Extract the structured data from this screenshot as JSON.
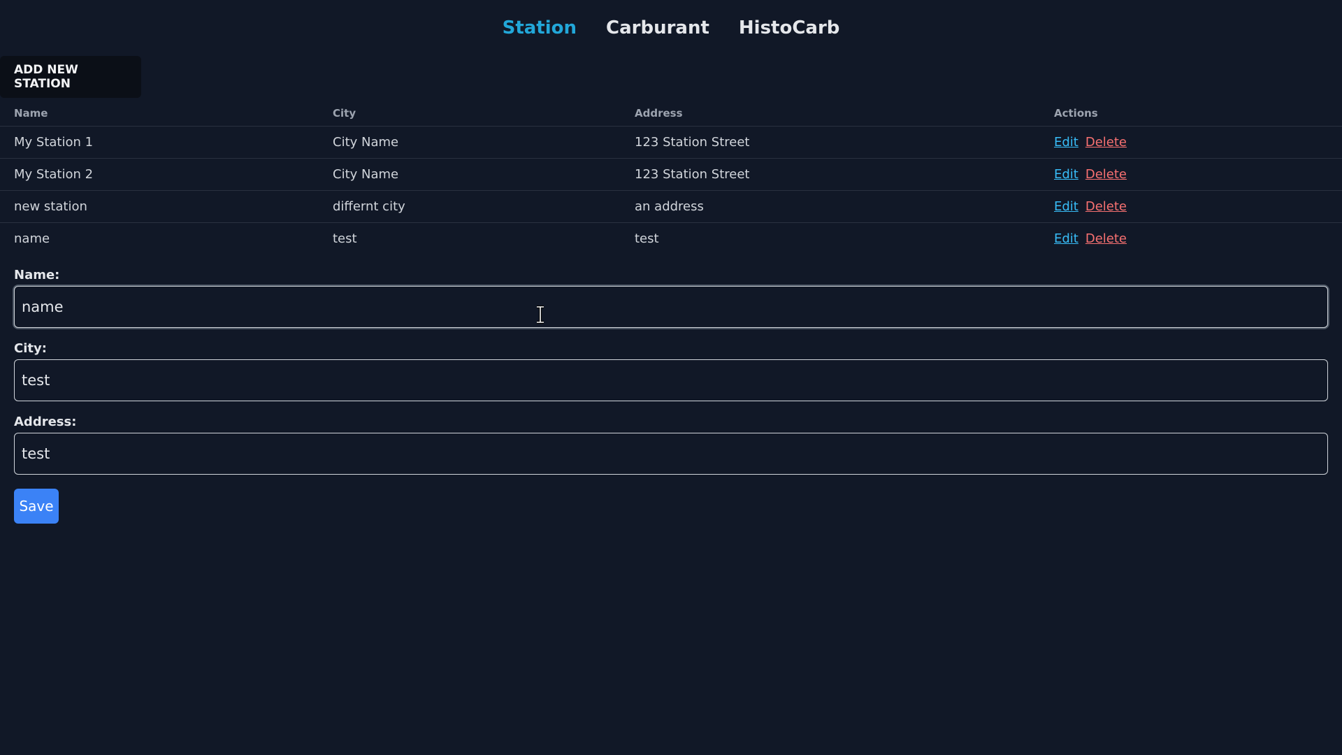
{
  "nav": {
    "items": [
      {
        "label": "Station",
        "active": true
      },
      {
        "label": "Carburant",
        "active": false
      },
      {
        "label": "HistoCarb",
        "active": false
      }
    ]
  },
  "add_button_label": "ADD NEW STATION",
  "table": {
    "headers": [
      "Name",
      "City",
      "Address",
      "Actions"
    ],
    "rows": [
      {
        "name": "My Station 1",
        "city": "City Name",
        "address": "123 Station Street",
        "edit": "Edit",
        "delete": "Delete"
      },
      {
        "name": "My Station 2",
        "city": "City Name",
        "address": "123 Station Street",
        "edit": "Edit",
        "delete": "Delete"
      },
      {
        "name": "new station",
        "city": "differnt city",
        "address": "an address",
        "edit": "Edit",
        "delete": "Delete"
      },
      {
        "name": "name",
        "city": "test",
        "address": "test",
        "edit": "Edit",
        "delete": "Delete"
      }
    ]
  },
  "form": {
    "name_label": "Name:",
    "name_value": "name",
    "city_label": "City:",
    "city_value": "test",
    "address_label": "Address:",
    "address_value": "test",
    "save_label": "Save"
  },
  "colors": {
    "background": "#111827",
    "active_nav": "#22a7d9",
    "edit_link": "#38bdf8",
    "delete_link": "#f87171",
    "save_button": "#3b82f6"
  },
  "cursor_icon": "text-cursor-icon"
}
